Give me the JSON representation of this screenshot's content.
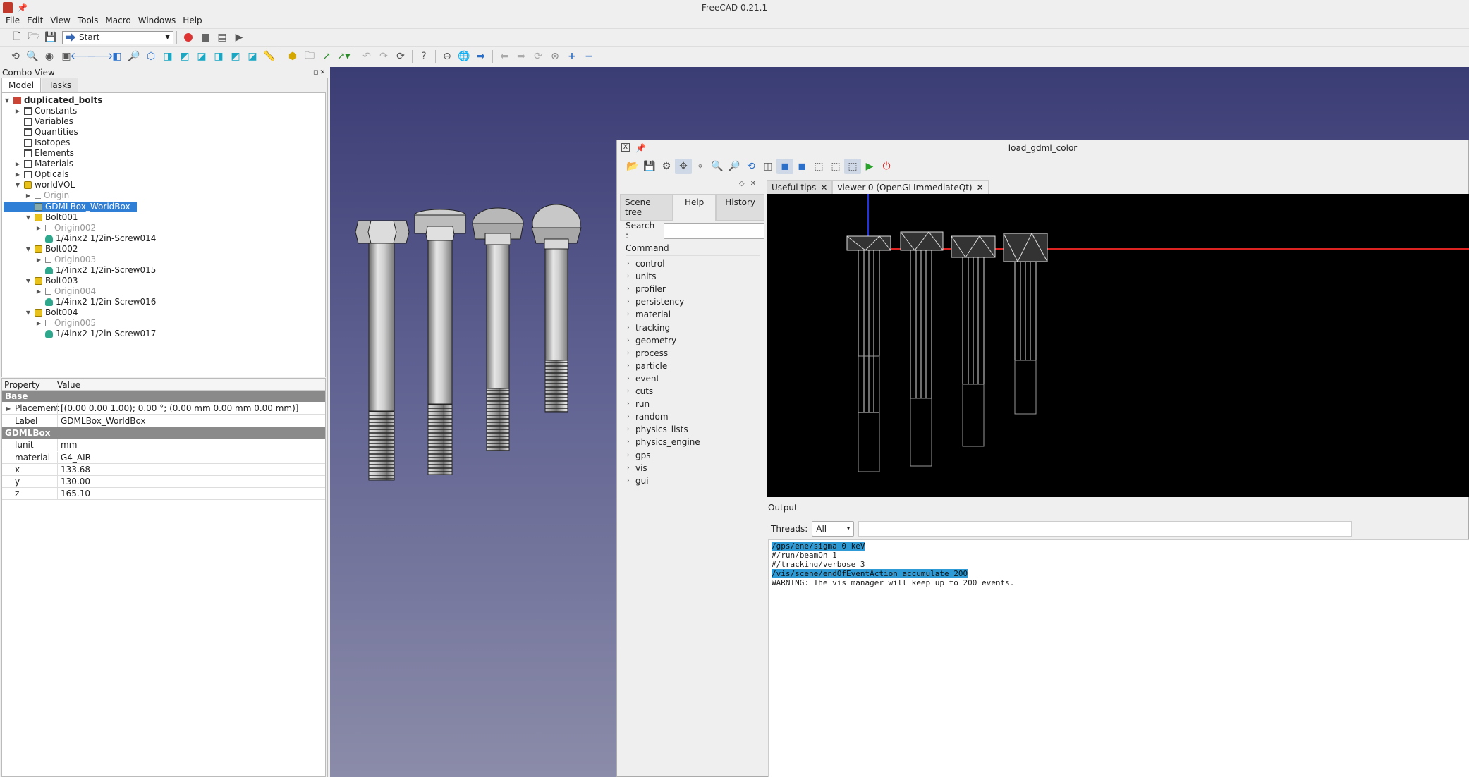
{
  "window": {
    "title": "FreeCAD 0.21.1"
  },
  "menu": [
    "File",
    "Edit",
    "View",
    "Tools",
    "Macro",
    "Windows",
    "Help"
  ],
  "workbench": {
    "selected": "Start"
  },
  "combo": {
    "title": "Combo View",
    "tabs": [
      "Model",
      "Tasks"
    ],
    "tree": [
      {
        "label": "duplicated_bolts",
        "icon": "document-icon",
        "depth": 0,
        "expander": "open",
        "bold": true
      },
      {
        "label": "Constants",
        "icon": "folder-icon",
        "depth": 1,
        "expander": "closed"
      },
      {
        "label": "Variables",
        "icon": "folder-icon",
        "depth": 1,
        "expander": "none"
      },
      {
        "label": "Quantities",
        "icon": "folder-icon",
        "depth": 1,
        "expander": "none"
      },
      {
        "label": "Isotopes",
        "icon": "folder-icon",
        "depth": 1,
        "expander": "none"
      },
      {
        "label": "Elements",
        "icon": "folder-icon",
        "depth": 1,
        "expander": "none"
      },
      {
        "label": "Materials",
        "icon": "folder-icon",
        "depth": 1,
        "expander": "closed"
      },
      {
        "label": "Opticals",
        "icon": "folder-icon",
        "depth": 1,
        "expander": "closed"
      },
      {
        "label": "worldVOL",
        "icon": "part-icon",
        "depth": 1,
        "expander": "open"
      },
      {
        "label": "Origin",
        "icon": "origin-icon",
        "depth": 2,
        "expander": "closed",
        "dim": true
      },
      {
        "label": "GDMLBox_WorldBox",
        "icon": "box-icon",
        "depth": 2,
        "expander": "none",
        "selected": true
      },
      {
        "label": "Bolt001",
        "icon": "part-icon",
        "depth": 2,
        "expander": "open"
      },
      {
        "label": "Origin002",
        "icon": "origin-icon",
        "depth": 3,
        "expander": "closed",
        "dim": true
      },
      {
        "label": "1/4inx2 1/2in-Screw014",
        "icon": "solid-icon",
        "depth": 3,
        "expander": "none"
      },
      {
        "label": "Bolt002",
        "icon": "part-icon",
        "depth": 2,
        "expander": "open"
      },
      {
        "label": "Origin003",
        "icon": "origin-icon",
        "depth": 3,
        "expander": "closed",
        "dim": true
      },
      {
        "label": "1/4inx2 1/2in-Screw015",
        "icon": "solid-icon",
        "depth": 3,
        "expander": "none"
      },
      {
        "label": "Bolt003",
        "icon": "part-icon",
        "depth": 2,
        "expander": "open"
      },
      {
        "label": "Origin004",
        "icon": "origin-icon",
        "depth": 3,
        "expander": "closed",
        "dim": true
      },
      {
        "label": "1/4inx2 1/2in-Screw016",
        "icon": "solid-icon",
        "depth": 3,
        "expander": "none"
      },
      {
        "label": "Bolt004",
        "icon": "part-icon",
        "depth": 2,
        "expander": "open"
      },
      {
        "label": "Origin005",
        "icon": "origin-icon",
        "depth": 3,
        "expander": "closed",
        "dim": true
      },
      {
        "label": "1/4inx2 1/2in-Screw017",
        "icon": "solid-icon",
        "depth": 3,
        "expander": "none"
      }
    ],
    "properties": {
      "header": [
        "Property",
        "Value"
      ],
      "groups": [
        {
          "name": "Base",
          "rows": [
            {
              "key": "Placement",
              "value": "[(0.00 0.00 1.00); 0.00 °; (0.00 mm  0.00 mm  0.00 mm)]",
              "expander": true
            },
            {
              "key": "Label",
              "value": "GDMLBox_WorldBox"
            }
          ]
        },
        {
          "name": "GDMLBox",
          "rows": [
            {
              "key": "lunit",
              "value": "mm"
            },
            {
              "key": "material",
              "value": "G4_AIR"
            },
            {
              "key": "x",
              "value": "133.68"
            },
            {
              "key": "y",
              "value": "130.00"
            },
            {
              "key": "z",
              "value": "165.10"
            }
          ]
        }
      ]
    }
  },
  "g4": {
    "title": "load_gdml_color",
    "left_tabs": [
      "Scene tree",
      "Help",
      "History"
    ],
    "active_left_tab": "Help",
    "search_label": "Search :",
    "command_header": "Command",
    "commands": [
      "control",
      "units",
      "profiler",
      "persistency",
      "material",
      "tracking",
      "geometry",
      "process",
      "particle",
      "event",
      "cuts",
      "run",
      "random",
      "physics_lists",
      "physics_engine",
      "gps",
      "vis",
      "gui"
    ],
    "right_tabs": [
      "Useful tips",
      "viewer-0 (OpenGLImmediateQt)"
    ],
    "output_label": "Output",
    "threads_label": "Threads:",
    "threads_value": "All",
    "console": [
      {
        "text": "/gps/ene/sigma 0 keV",
        "highlight": true
      },
      {
        "text": "#/run/beamOn 1",
        "highlight": false
      },
      {
        "text": "#/tracking/verbose 3",
        "highlight": false
      },
      {
        "text": "/vis/scene/endOfEventAction accumulate 200",
        "highlight": true
      },
      {
        "text": "WARNING: The vis manager will keep up to 200 events.",
        "highlight": false
      }
    ]
  }
}
